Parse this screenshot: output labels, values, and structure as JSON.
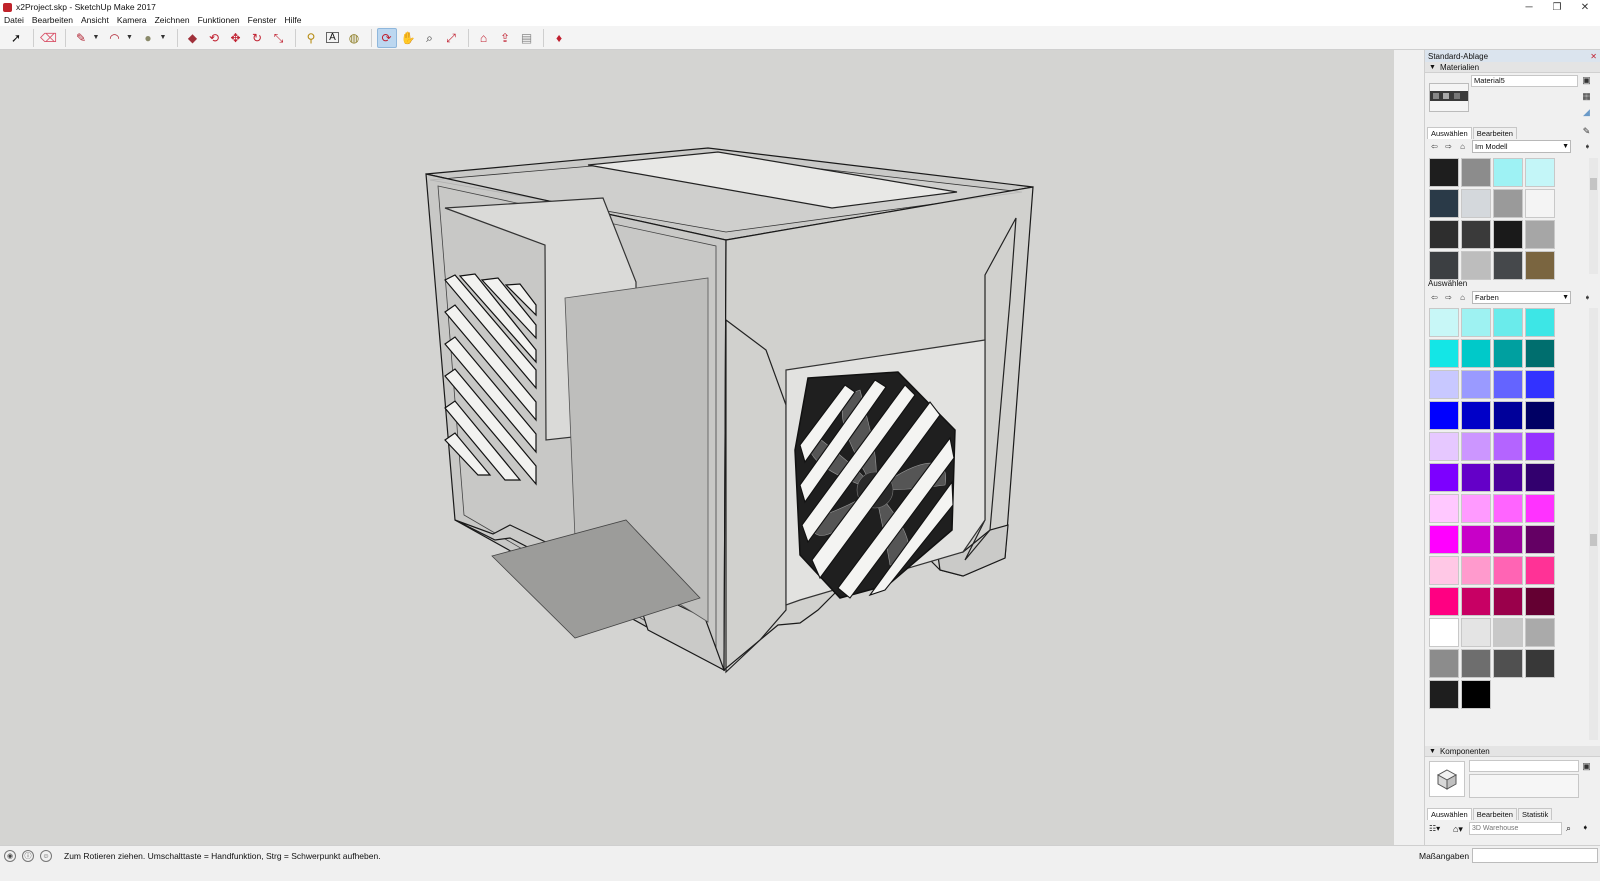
{
  "window": {
    "title": "x2Project.skp - SketchUp Make 2017"
  },
  "window_controls": [
    "─",
    "❐",
    "✕"
  ],
  "menu": [
    "Datei",
    "Bearbeiten",
    "Ansicht",
    "Kamera",
    "Zeichnen",
    "Funktionen",
    "Fenster",
    "Hilfe"
  ],
  "toolbar": {
    "tools": [
      {
        "name": "select-tool",
        "glyph": "➚"
      },
      {
        "name": "eraser-tool",
        "glyph": "⌫"
      },
      {
        "name": "pencil-tool",
        "glyph": "✎"
      },
      {
        "name": "arc-tool",
        "glyph": "◠"
      },
      {
        "name": "shape-tool",
        "glyph": "●"
      },
      {
        "name": "pushpull-tool",
        "glyph": "◆"
      },
      {
        "name": "offset-tool",
        "glyph": "⟲"
      },
      {
        "name": "move-tool",
        "glyph": "✥"
      },
      {
        "name": "rotate-tool",
        "glyph": "↻"
      },
      {
        "name": "scale-tool",
        "glyph": "⤡"
      },
      {
        "name": "tape-tool",
        "glyph": "⚲"
      },
      {
        "name": "text-tool",
        "glyph": "A"
      },
      {
        "name": "paint-tool",
        "glyph": "◍"
      },
      {
        "name": "orbit-tool",
        "glyph": "⟳"
      },
      {
        "name": "pan-tool",
        "glyph": "✋"
      },
      {
        "name": "zoom-tool",
        "glyph": "⌕"
      },
      {
        "name": "zoom-extents-tool",
        "glyph": "⤢"
      },
      {
        "name": "warehouse-tool",
        "glyph": "⌂"
      },
      {
        "name": "share-model-tool",
        "glyph": "⇪"
      },
      {
        "name": "extension-warehouse-tool",
        "glyph": "▤"
      },
      {
        "name": "ruby-tool",
        "glyph": "♦"
      }
    ]
  },
  "tray": {
    "title": "Standard-Ablage",
    "materials": {
      "header": "Materialien",
      "material_name": "Material5",
      "tab_select": "Auswählen",
      "tab_edit": "Bearbeiten",
      "collection": "Im Modell",
      "model_swatches": [
        "#1e1e1e",
        "#8c8c8c",
        "#9ef2f4",
        "#c4f6f8",
        "#2a3a48",
        "#d4d8dc",
        "#9a9a9a",
        "#f4f4f4",
        "#2e2e2e",
        "#3a3a3a",
        "#1a1a1a",
        "#a6a6a6",
        "#3c3f42",
        "#bdbdbd",
        "#45484b",
        "#7a6540"
      ],
      "second_label": "Auswählen",
      "second_collection": "Farben",
      "color_swatches": [
        "#c8f7f7",
        "#9ef2f2",
        "#6aebeb",
        "#3de6e6",
        "#14e6e6",
        "#00c9c9",
        "#00a0a0",
        "#006e6e",
        "#c8c8ff",
        "#9a9aff",
        "#6464ff",
        "#3232ff",
        "#0000ff",
        "#0000c8",
        "#00009a",
        "#000064",
        "#e6c8ff",
        "#cc96ff",
        "#b464ff",
        "#9632ff",
        "#7d00ff",
        "#6400c8",
        "#4b009a",
        "#32006e",
        "#ffc8ff",
        "#ff9aff",
        "#ff64ff",
        "#ff32ff",
        "#ff00ff",
        "#c800c8",
        "#9a009a",
        "#640064",
        "#ffc8e6",
        "#ff9acd",
        "#ff64b4",
        "#ff3296",
        "#ff0082",
        "#c80064",
        "#9a004b",
        "#640032",
        "#ffffff",
        "#e4e4e4",
        "#c8c8c8",
        "#aaaaaa",
        "#8c8c8c",
        "#6e6e6e",
        "#505050",
        "#383838",
        "#1e1e1e",
        "#000000"
      ]
    },
    "components": {
      "header": "Komponenten",
      "tab_select": "Auswählen",
      "tab_edit": "Bearbeiten",
      "tab_stats": "Statistik",
      "search_placeholder": "3D Warehouse"
    }
  },
  "status": {
    "hint": "Zum Rotieren ziehen. Umschalttaste = Handfunktion, Strg = Schwerpunkt aufheben.",
    "measurements_label": "Maßangaben",
    "measurements_value": ""
  }
}
